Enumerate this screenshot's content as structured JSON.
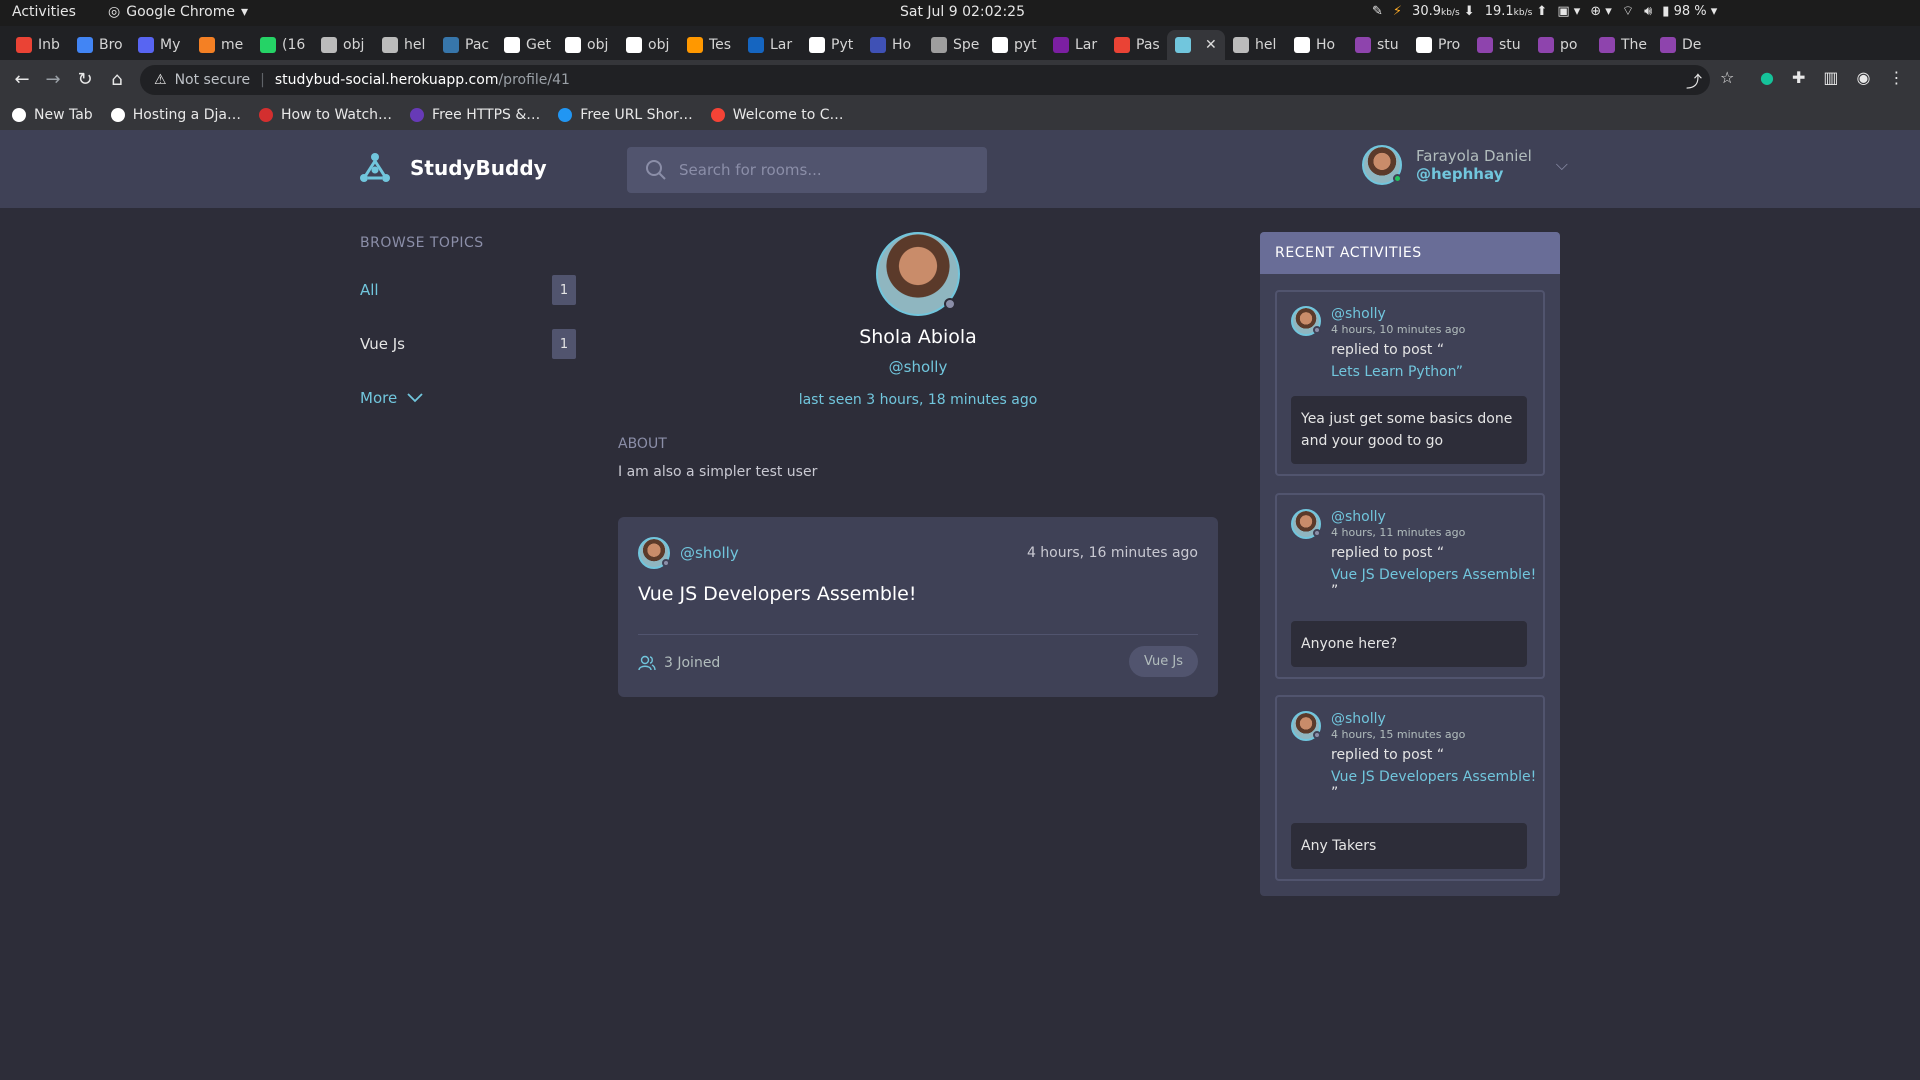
{
  "os": {
    "activities": "Activities",
    "app_name": "Google Chrome",
    "clock": "Sat Jul 9  02:02:25",
    "net_down": "30.9",
    "net_up": "19.1",
    "net_unit": "kb/s",
    "battery": "98 %"
  },
  "browser": {
    "tabs": [
      {
        "label": "Inb",
        "icon": "gmail-icon",
        "color": "#ea4335"
      },
      {
        "label": "Bro",
        "icon": "google-icon",
        "color": "#4285f4"
      },
      {
        "label": "My",
        "icon": "people-icon",
        "color": "#5865f2"
      },
      {
        "label": "me",
        "icon": "stack-icon",
        "color": "#f48024"
      },
      {
        "label": "(16",
        "icon": "whatsapp-icon",
        "color": "#25d366"
      },
      {
        "label": "obj",
        "icon": "github-icon",
        "color": "#bbbbbb"
      },
      {
        "label": "hel",
        "icon": "github-icon",
        "color": "#bbbbbb"
      },
      {
        "label": "Pac",
        "icon": "python-icon",
        "color": "#3776ab"
      },
      {
        "label": "Get",
        "icon": "puzzle-icon",
        "color": "#ffffff"
      },
      {
        "label": "obj",
        "icon": "hexagon-icon",
        "color": "#ffffff"
      },
      {
        "label": "obj",
        "icon": "hexagon-icon",
        "color": "#ffffff"
      },
      {
        "label": "Tes",
        "icon": "infinity-icon",
        "color": "#ff9800"
      },
      {
        "label": "Lar",
        "icon": "doc-icon",
        "color": "#1565c0"
      },
      {
        "label": "Pyt",
        "icon": "puzzle-icon",
        "color": "#ffffff"
      },
      {
        "label": "Ho",
        "icon": "p-icon",
        "color": "#3f51b5"
      },
      {
        "label": "Spe",
        "icon": "spec-icon",
        "color": "#9e9e9e"
      },
      {
        "label": "pyt",
        "icon": "hexagon-icon",
        "color": "#ffffff"
      },
      {
        "label": "Lar",
        "icon": "d-icon",
        "color": "#7b1fa2"
      },
      {
        "label": "Pas",
        "icon": "gmail-icon",
        "color": "#ea4335"
      },
      {
        "label": "",
        "icon": "studybuddy-icon",
        "color": "#71c6dd",
        "active": true
      },
      {
        "label": "hel",
        "icon": "github-icon",
        "color": "#bbbbbb"
      },
      {
        "label": "Ho",
        "icon": "puzzle-icon",
        "color": "#ffffff"
      },
      {
        "label": "stu",
        "icon": "h-icon",
        "color": "#8e44ad"
      },
      {
        "label": "Pro",
        "icon": "globe-icon",
        "color": "#ffffff"
      },
      {
        "label": "stu",
        "icon": "h-icon",
        "color": "#8e44ad"
      },
      {
        "label": "po",
        "icon": "h-icon",
        "color": "#8e44ad"
      },
      {
        "label": "The",
        "icon": "h-icon",
        "color": "#8e44ad"
      },
      {
        "label": "De",
        "icon": "h-icon",
        "color": "#8e44ad"
      }
    ],
    "not_secure": "Not secure",
    "url_host": "studybud-social.herokuapp.com",
    "url_path": "/profile/41",
    "bookmarks": [
      {
        "label": "New Tab",
        "icon": "globe-icon",
        "color": "#ffffff"
      },
      {
        "label": "Hosting a Dja…",
        "icon": "puzzle-icon",
        "color": "#ffffff"
      },
      {
        "label": "How to Watch…",
        "icon": "pc-icon",
        "color": "#d32f2f"
      },
      {
        "label": "Free HTTPS &…",
        "icon": "cert-icon",
        "color": "#673ab7"
      },
      {
        "label": "Free URL Shor…",
        "icon": "link-icon",
        "color": "#2196f3"
      },
      {
        "label": "Welcome to C…",
        "icon": "flame-icon",
        "color": "#f44336"
      }
    ]
  },
  "header": {
    "logo_text": "StudyBuddy",
    "search_placeholder": "Search for rooms...",
    "user_name": "Farayola Daniel",
    "user_handle": "@hephhay",
    "online_color": "#22c55e"
  },
  "topics": {
    "title": "BROWSE TOPICS",
    "items": [
      {
        "name": "All",
        "count": "1",
        "active": true
      },
      {
        "name": "Vue Js",
        "count": "1",
        "active": false
      }
    ],
    "more_label": "More"
  },
  "profile": {
    "name": "Shola Abiola",
    "handle": "@sholly",
    "last_seen": "last seen 3 hours, 18 minutes ago",
    "about_title": "ABOUT",
    "about_text": "I am also a simpler test user"
  },
  "room": {
    "host": "@sholly",
    "time": "4 hours, 16 minutes ago",
    "title": "Vue JS Developers Assemble!",
    "joined": "3 Joined",
    "topic": "Vue Js"
  },
  "activities": {
    "title": "RECENT ACTIVITIES",
    "items": [
      {
        "user": "@sholly",
        "time": "4 hours, 10 minutes ago",
        "action": "replied to post “",
        "link": "Lets Learn Python”",
        "close": "",
        "message": "Yea just get some basics done and your good to go"
      },
      {
        "user": "@sholly",
        "time": "4 hours, 11 minutes ago",
        "action": "replied to post “",
        "link": "Vue JS Developers Assemble!",
        "close": "”",
        "message": "Anyone here?"
      },
      {
        "user": "@sholly",
        "time": "4 hours, 15 minutes ago",
        "action": "replied to post “",
        "link": "Vue JS Developers Assemble!",
        "close": "”",
        "message": "Any Takers"
      }
    ]
  }
}
